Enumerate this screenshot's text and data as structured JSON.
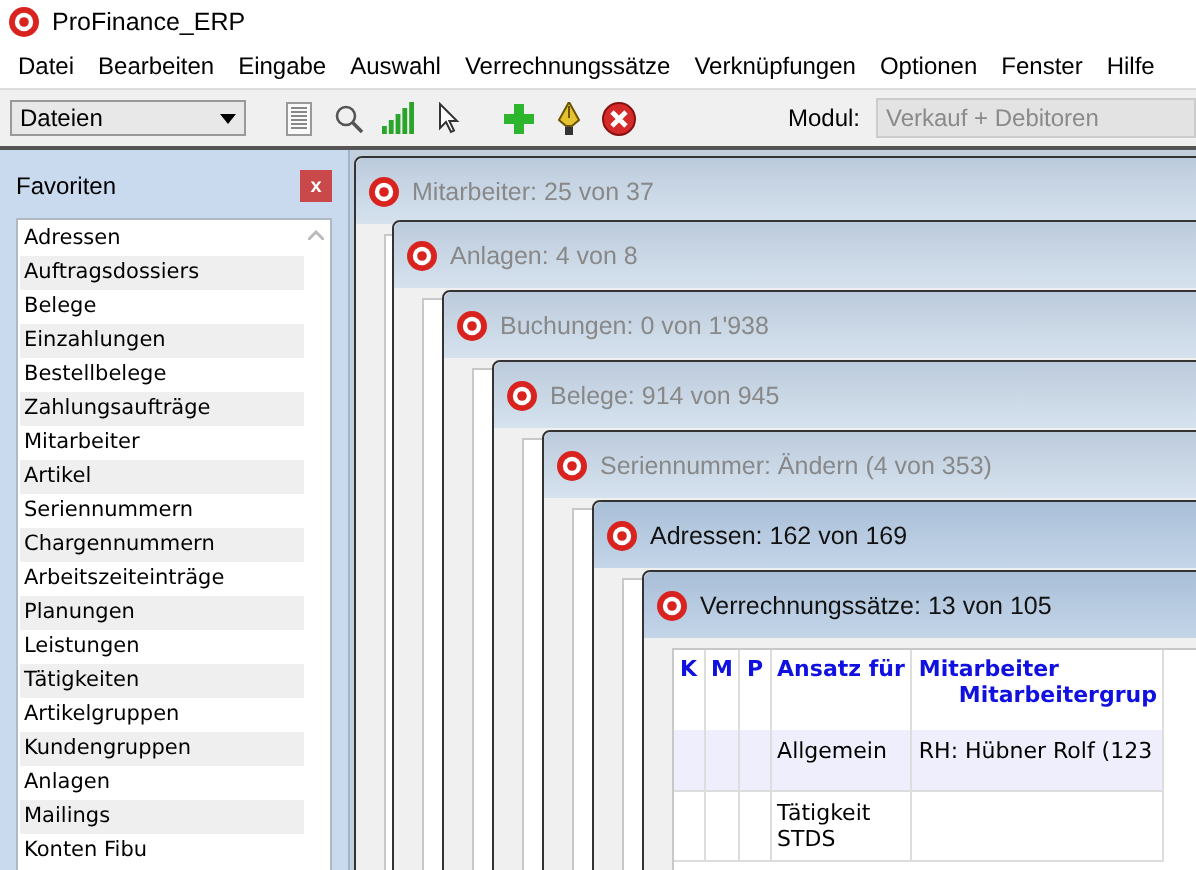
{
  "window": {
    "title": "ProFinance_ERP"
  },
  "menu": [
    "Datei",
    "Bearbeiten",
    "Eingabe",
    "Auswahl",
    "Verrechnungssätze",
    "Verknüpfungen",
    "Optionen",
    "Fenster",
    "Hilfe"
  ],
  "toolbar": {
    "dropdown": "Dateien",
    "module_label": "Modul:",
    "module_value": "Verkauf + Debitoren"
  },
  "favorites": {
    "title": "Favoriten",
    "close": "x",
    "items": [
      "Adressen",
      "Auftragsdossiers",
      "Belege",
      "Einzahlungen",
      "Bestellbelege",
      "Zahlungsaufträge",
      "Mitarbeiter",
      "Artikel",
      "Seriennummern",
      "Chargennummern",
      "Arbeitszeiteinträge",
      "Planungen",
      "Leistungen",
      "Tätigkeiten",
      "Artikelgruppen",
      "Kundengruppen",
      "Anlagen",
      "Mailings",
      "Konten Fibu"
    ]
  },
  "windows": [
    {
      "title": "Mitarbeiter: 25 von 37",
      "active": false
    },
    {
      "title": "Anlagen: 4 von 8",
      "active": false
    },
    {
      "title": "Buchungen: 0 von 1'938",
      "active": false
    },
    {
      "title": "Belege: 914 von 945",
      "active": false
    },
    {
      "title": "Seriennummer: Ändern (4 von 353)",
      "active": false
    },
    {
      "title": "Adressen: 162 von 169",
      "active": true
    },
    {
      "title": "Verrechnungssätze: 13 von 105",
      "active": true,
      "table": {
        "columns": [
          {
            "lines": [
              "K"
            ]
          },
          {
            "lines": [
              "M"
            ]
          },
          {
            "lines": [
              "P"
            ]
          },
          {
            "lines": [
              "Ansatz für"
            ]
          },
          {
            "lines": [
              "Mitarbeiter",
              "Mitarbeitergrup"
            ]
          }
        ],
        "rows": [
          {
            "ansatz": [
              "Allgemein"
            ],
            "mitarbeiter": "RH: Hübner Rolf (123"
          },
          {
            "ansatz": [
              "Tätigkeit",
              "STDS"
            ]
          }
        ]
      }
    }
  ]
}
